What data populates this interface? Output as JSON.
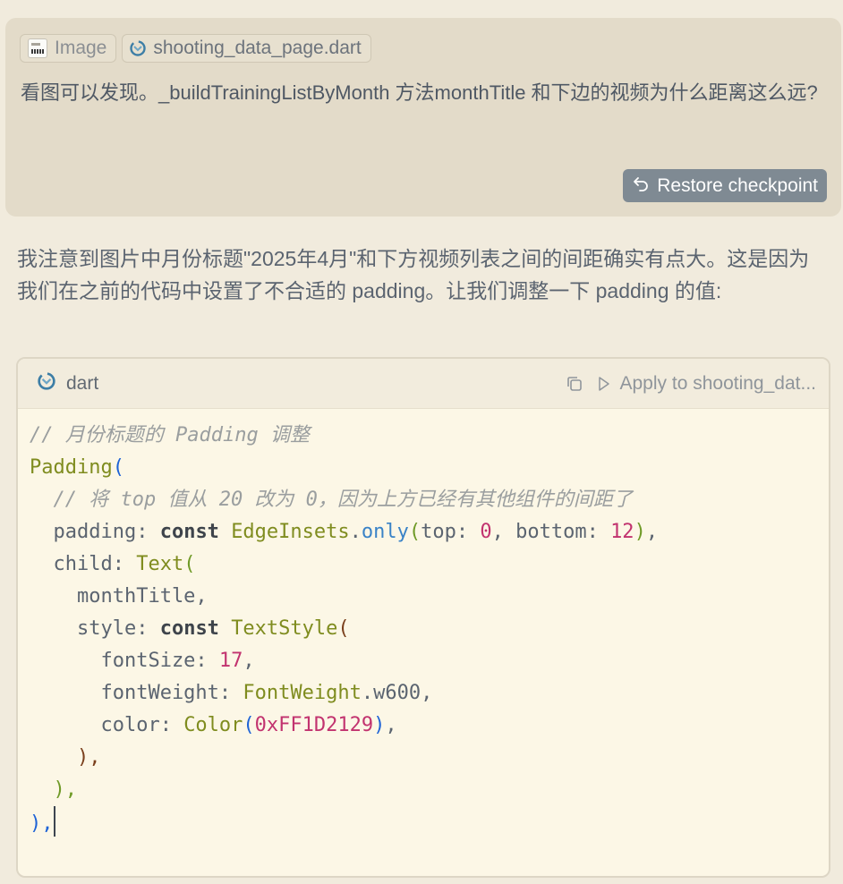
{
  "user_message": {
    "attachments": [
      {
        "label": "Image",
        "icon": "image-thumbnail-icon"
      },
      {
        "label": "shooting_data_page.dart",
        "icon": "dart-file-icon"
      }
    ],
    "text": "看图可以发现。_buildTrainingListByMonth 方法monthTitle 和下边的视频为什么距离这么远?",
    "restore_button": {
      "label": "Restore checkpoint",
      "icon": "undo-arrow-icon"
    }
  },
  "assistant_message": {
    "text": "我注意到图片中月份标题\"2025年4月\"和下方视频列表之间的间距确实有点大。这是因为我们在之前的代码中设置了不合适的 padding。让我们调整一下 padding 的值:"
  },
  "code_block": {
    "language": "dart",
    "apply_label": "Apply to shooting_dat...",
    "copy_icon": "copy-icon",
    "apply_icon": "play-icon",
    "lines": [
      [
        {
          "t": "// 月份标题的 Padding 调整",
          "c": "comment"
        }
      ],
      [
        {
          "t": "Padding",
          "c": "class"
        },
        {
          "t": "(",
          "c": "paren1"
        }
      ],
      [
        {
          "t": "  // 将 top 值从 20 改为 0，因为上方已经有其他组件的间距了",
          "c": "comment"
        }
      ],
      [
        {
          "t": "  padding: ",
          "c": "prop"
        },
        {
          "t": "const",
          "c": "keyword"
        },
        {
          "t": " ",
          "c": "punct"
        },
        {
          "t": "EdgeInsets",
          "c": "class"
        },
        {
          "t": ".",
          "c": "punct"
        },
        {
          "t": "only",
          "c": "method"
        },
        {
          "t": "(",
          "c": "paren2"
        },
        {
          "t": "top: ",
          "c": "prop"
        },
        {
          "t": "0",
          "c": "number"
        },
        {
          "t": ", bottom: ",
          "c": "prop"
        },
        {
          "t": "12",
          "c": "number"
        },
        {
          "t": ")",
          "c": "paren2"
        },
        {
          "t": ",",
          "c": "punct"
        }
      ],
      [
        {
          "t": "  child: ",
          "c": "prop"
        },
        {
          "t": "Text",
          "c": "class"
        },
        {
          "t": "(",
          "c": "paren2"
        }
      ],
      [
        {
          "t": "    monthTitle,",
          "c": "prop"
        }
      ],
      [
        {
          "t": "    style: ",
          "c": "prop"
        },
        {
          "t": "const",
          "c": "keyword"
        },
        {
          "t": " ",
          "c": "punct"
        },
        {
          "t": "TextStyle",
          "c": "class"
        },
        {
          "t": "(",
          "c": "paren3"
        }
      ],
      [
        {
          "t": "      fontSize: ",
          "c": "prop"
        },
        {
          "t": "17",
          "c": "number"
        },
        {
          "t": ",",
          "c": "punct"
        }
      ],
      [
        {
          "t": "      fontWeight: ",
          "c": "prop"
        },
        {
          "t": "FontWeight",
          "c": "class"
        },
        {
          "t": ".w600,",
          "c": "prop"
        }
      ],
      [
        {
          "t": "      color: ",
          "c": "prop"
        },
        {
          "t": "Color",
          "c": "class"
        },
        {
          "t": "(",
          "c": "paren1"
        },
        {
          "t": "0xFF1D2129",
          "c": "number"
        },
        {
          "t": ")",
          "c": "paren1"
        },
        {
          "t": ",",
          "c": "punct"
        }
      ],
      [
        {
          "t": "    ),",
          "c": "paren3"
        }
      ],
      [
        {
          "t": "  ),",
          "c": "paren2"
        }
      ],
      [
        {
          "t": "),",
          "c": "paren1"
        },
        {
          "t": "",
          "c": "caret"
        }
      ]
    ]
  },
  "colors": {
    "background": "#f1ebdd",
    "user_card": "#e3dbc9",
    "restore_button": "#7f8a93",
    "code_background": "#fcf7e6",
    "code_header": "#f2ecdd",
    "dart_icon": "#3d7ea6"
  }
}
